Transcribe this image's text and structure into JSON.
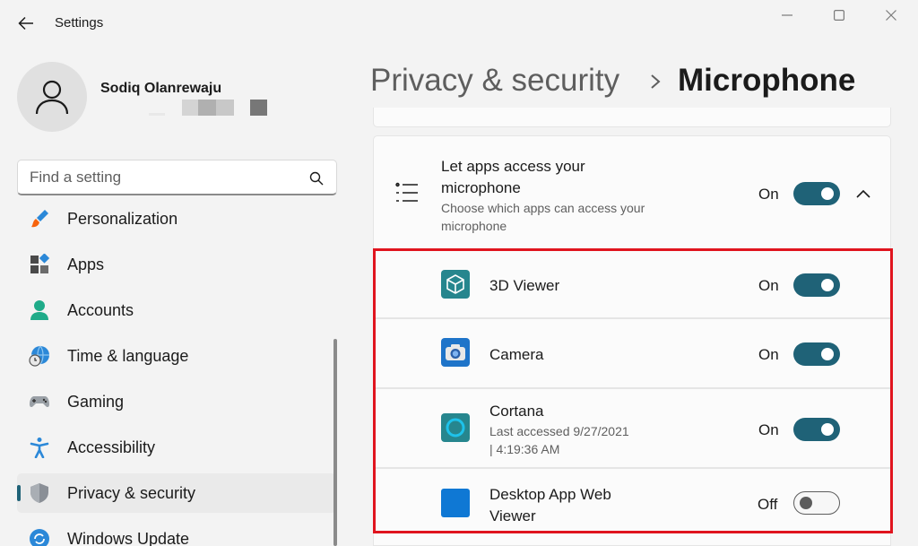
{
  "window": {
    "title": "Settings",
    "back_label": "Back",
    "controls": [
      "minimize",
      "maximize",
      "close"
    ]
  },
  "profile": {
    "name": "Sodiq Olanrewaju"
  },
  "search": {
    "placeholder": "Find a setting"
  },
  "sidebar": {
    "items": [
      {
        "label": "Personalization",
        "icon": "brush-icon"
      },
      {
        "label": "Apps",
        "icon": "apps-icon"
      },
      {
        "label": "Accounts",
        "icon": "person-icon"
      },
      {
        "label": "Time & language",
        "icon": "globe-clock-icon"
      },
      {
        "label": "Gaming",
        "icon": "gamepad-icon"
      },
      {
        "label": "Accessibility",
        "icon": "accessibility-icon"
      },
      {
        "label": "Privacy & security",
        "icon": "shield-icon",
        "selected": true
      },
      {
        "label": "Windows Update",
        "icon": "update-icon"
      }
    ]
  },
  "breadcrumb": {
    "parent": "Privacy & security",
    "current": "Microphone"
  },
  "master_setting": {
    "title": "Let apps access your microphone",
    "description": "Choose which apps can access your microphone",
    "state": "On",
    "enabled": true
  },
  "apps": [
    {
      "name": "3D Viewer",
      "detail": "",
      "state": "On",
      "enabled": true,
      "icon": "cube-icon"
    },
    {
      "name": "Camera",
      "detail": "",
      "state": "On",
      "enabled": true,
      "icon": "camera-icon"
    },
    {
      "name": "Cortana",
      "detail": "Last accessed 9/27/2021 | 4:19:36 AM",
      "detail_line1": "Last accessed 9/27/2021",
      "detail_line2": "|  4:19:36 AM",
      "state": "On",
      "enabled": true,
      "icon": "cortana-icon"
    },
    {
      "name": "Desktop App Web Viewer",
      "detail": "",
      "state": "Off",
      "enabled": false,
      "icon": "webview-icon"
    }
  ],
  "colors": {
    "accent": "#1f6277",
    "highlight_border": "#e0141e",
    "background": "#f3f3f3",
    "card": "#fbfbfb"
  }
}
